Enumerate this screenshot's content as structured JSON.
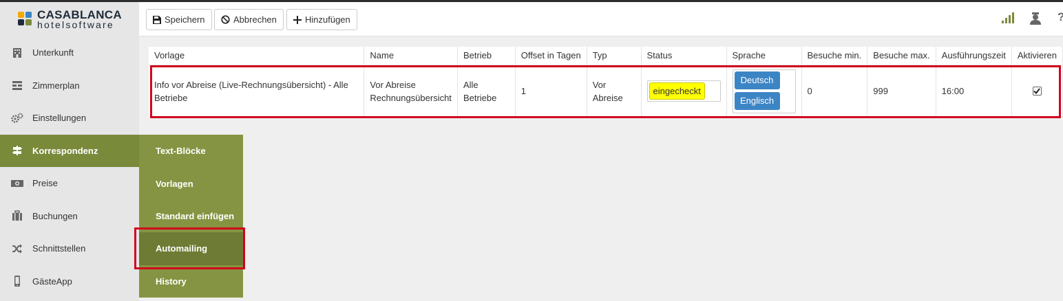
{
  "logo": {
    "line1": "CASABLANCA",
    "line2": "hotelsoftware"
  },
  "sidebar": {
    "items": [
      {
        "label": "Unterkunft",
        "icon": "building-icon"
      },
      {
        "label": "Zimmerplan",
        "icon": "room-plan-icon"
      },
      {
        "label": "Einstellungen",
        "icon": "gears-icon"
      },
      {
        "label": "Korrespondenz",
        "icon": "signpost-icon",
        "active": true
      },
      {
        "label": "Preise",
        "icon": "money-icon"
      },
      {
        "label": "Buchungen",
        "icon": "suitcase-icon"
      },
      {
        "label": "Schnittstellen",
        "icon": "shuffle-icon"
      },
      {
        "label": "GästeApp",
        "icon": "mobile-icon"
      }
    ]
  },
  "submenu": {
    "items": [
      {
        "label": "Text-Blöcke"
      },
      {
        "label": "Vorlagen"
      },
      {
        "label": "Standard einfügen"
      },
      {
        "label": "Automailing",
        "active": true
      },
      {
        "label": "History"
      }
    ]
  },
  "toolbar": {
    "save_label": "Speichern",
    "cancel_label": "Abbrechen",
    "add_label": "Hinzufügen"
  },
  "table": {
    "headers": [
      "Vorlage",
      "Name",
      "Betrieb",
      "Offset in Tagen",
      "Typ",
      "Status",
      "Sprache",
      "Besuche min.",
      "Besuche max.",
      "Ausführungszeit",
      "Aktivieren"
    ],
    "row": {
      "vorlage": "Info vor Abreise (Live-Rechnungsübersicht) - Alle Betriebe",
      "name_line1": "Vor Abreise",
      "name_line2": "Rechnungsübersicht",
      "betrieb": "Alle Betriebe",
      "offset": "1",
      "typ": "Vor Abreise",
      "status": "eingecheckt",
      "languages": [
        "Deutsch",
        "Englisch"
      ],
      "besuche_min": "0",
      "besuche_max": "999",
      "ausfuehrungszeit": "16:00",
      "aktivieren": true
    }
  },
  "colors": {
    "accent": "#7a8a3b",
    "submenu": "#859442",
    "highlight": "#d0021b",
    "status_bg": "#ffff00",
    "lang_button": "#3c85c5"
  }
}
